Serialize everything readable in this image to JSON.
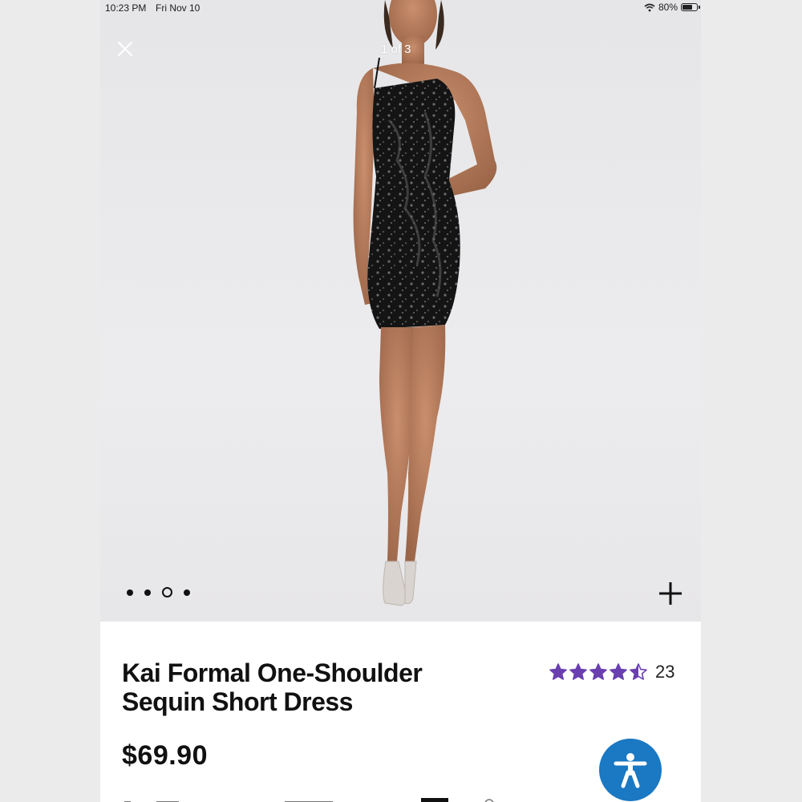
{
  "status_bar": {
    "time": "10:23 PM",
    "date": "Fri Nov 10",
    "battery": "80%",
    "battery_level": 0.8
  },
  "gallery": {
    "counter": "1 of 3",
    "dot_count": 4,
    "active_index": 2
  },
  "product": {
    "title_line1": "Kai Formal One-Shoulder",
    "title_line2": "Sequin Short Dress",
    "price": "$69.90",
    "rating": 4.5,
    "review_count": "23"
  },
  "colors": {
    "star": "#6a3fb0",
    "accessibility": "#1b78c2"
  },
  "icons": {
    "close": "close-icon",
    "expand": "plus-icon",
    "accessibility": "accessibility-icon",
    "wifi": "wifi-icon",
    "battery": "battery-icon"
  }
}
